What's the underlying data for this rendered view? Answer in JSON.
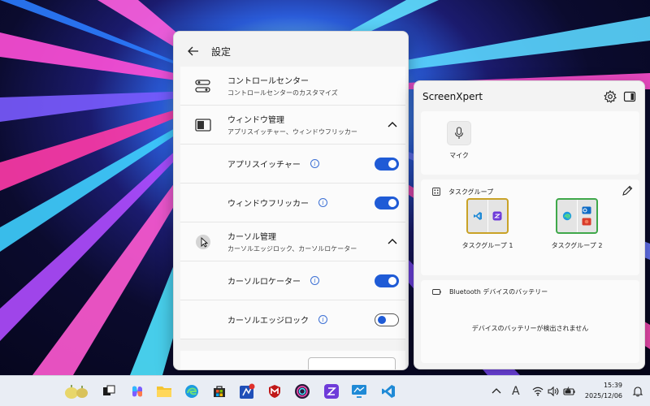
{
  "settings": {
    "title": "設定",
    "control_center": {
      "title": "コントロールセンター",
      "desc": "コントロールセンターのカスタマイズ"
    },
    "window_mgmt": {
      "title": "ウィンドウ管理",
      "desc": "アプリスイッチャー、ウィンドウフリッカー"
    },
    "app_switcher": {
      "title": "アプリスイッチャー",
      "enabled": true
    },
    "window_flicker": {
      "title": "ウィンドウフリッカー",
      "enabled": true
    },
    "cursor_mgmt": {
      "title": "カーソル管理",
      "desc": "カーソルエッジロック、カーソルロケーター"
    },
    "cursor_locator": {
      "title": "カーソルロケーター",
      "enabled": true
    },
    "cursor_edge_lock": {
      "title": "カーソルエッジロック",
      "enabled": false
    },
    "info_glyph": "i"
  },
  "screenxpert": {
    "title": "ScreenXpert",
    "mic_label": "マイク",
    "task_group": {
      "title": "タスクグループ",
      "groups": [
        {
          "label": "タスクグループ 1",
          "border": "#c9a227"
        },
        {
          "label": "タスクグループ 2",
          "border": "#3fa84a"
        }
      ]
    },
    "bluetooth": {
      "title": "Bluetooth デバイスのバッテリー",
      "empty": "デバイスのバッテリーが検出されません"
    }
  },
  "taskbar": {
    "tray_font_glyph": "A",
    "time": "15:39",
    "date": "2025/12/06"
  },
  "colors": {
    "accent": "#1f5bd6"
  }
}
